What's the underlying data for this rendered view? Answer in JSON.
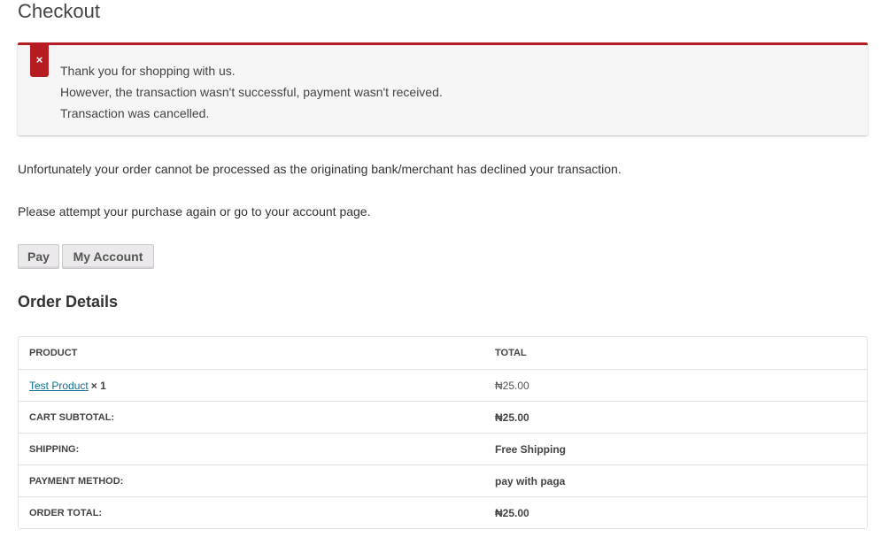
{
  "page": {
    "title": "Checkout"
  },
  "notice": {
    "icon": "×",
    "lines": [
      "Thank you for shopping with us.",
      "However, the transaction wasn't successful, payment wasn't received.",
      "Transaction was cancelled."
    ]
  },
  "messages": {
    "declined": "Unfortunately your order cannot be processed as the originating bank/merchant has declined your transaction.",
    "retry": "Please attempt your purchase again or go to your account page."
  },
  "buttons": {
    "pay": "Pay",
    "my_account": "My Account"
  },
  "order_details": {
    "title": "Order Details",
    "headers": {
      "product": "PRODUCT",
      "total": "TOTAL"
    },
    "item": {
      "name": "Test Product",
      "qty": "× 1",
      "total": "₦25.00"
    },
    "rows": [
      {
        "label": "CART SUBTOTAL:",
        "value": "₦25.00"
      },
      {
        "label": "SHIPPING:",
        "value": "Free Shipping"
      },
      {
        "label": "PAYMENT METHOD:",
        "value": "pay with paga"
      },
      {
        "label": "ORDER TOTAL:",
        "value": "₦25.00"
      }
    ]
  },
  "colors": {
    "error_accent": "#b81c23",
    "link": "#0f6f95"
  }
}
